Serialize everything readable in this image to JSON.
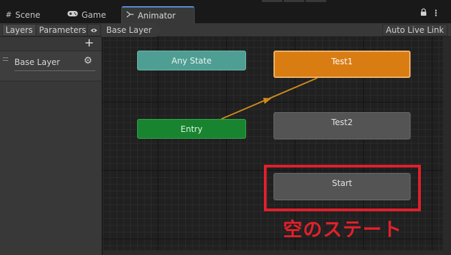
{
  "tabs": [
    {
      "label": "Scene",
      "icon": "grid-icon"
    },
    {
      "label": "Game",
      "icon": "gamepad-icon"
    },
    {
      "label": "Animator",
      "icon": "animator-icon",
      "active": true
    }
  ],
  "toolbar": {
    "layers_label": "Layers",
    "parameters_label": "Parameters",
    "breadcrumb": "Base Layer",
    "auto_live_link": "Auto Live Link"
  },
  "layers": [
    {
      "name": "Base Layer"
    }
  ],
  "graph": {
    "nodes": {
      "any_state": "Any State",
      "entry": "Entry",
      "test1": "Test1",
      "test2": "Test2",
      "start": "Start"
    }
  },
  "annotation": {
    "text": "空のステート",
    "color": "#e2202b"
  },
  "colors": {
    "default_state": "#d97c12",
    "entry": "#18842f",
    "any_state": "#4f9e93",
    "state": "#545454",
    "transition": "#d08a1a"
  }
}
